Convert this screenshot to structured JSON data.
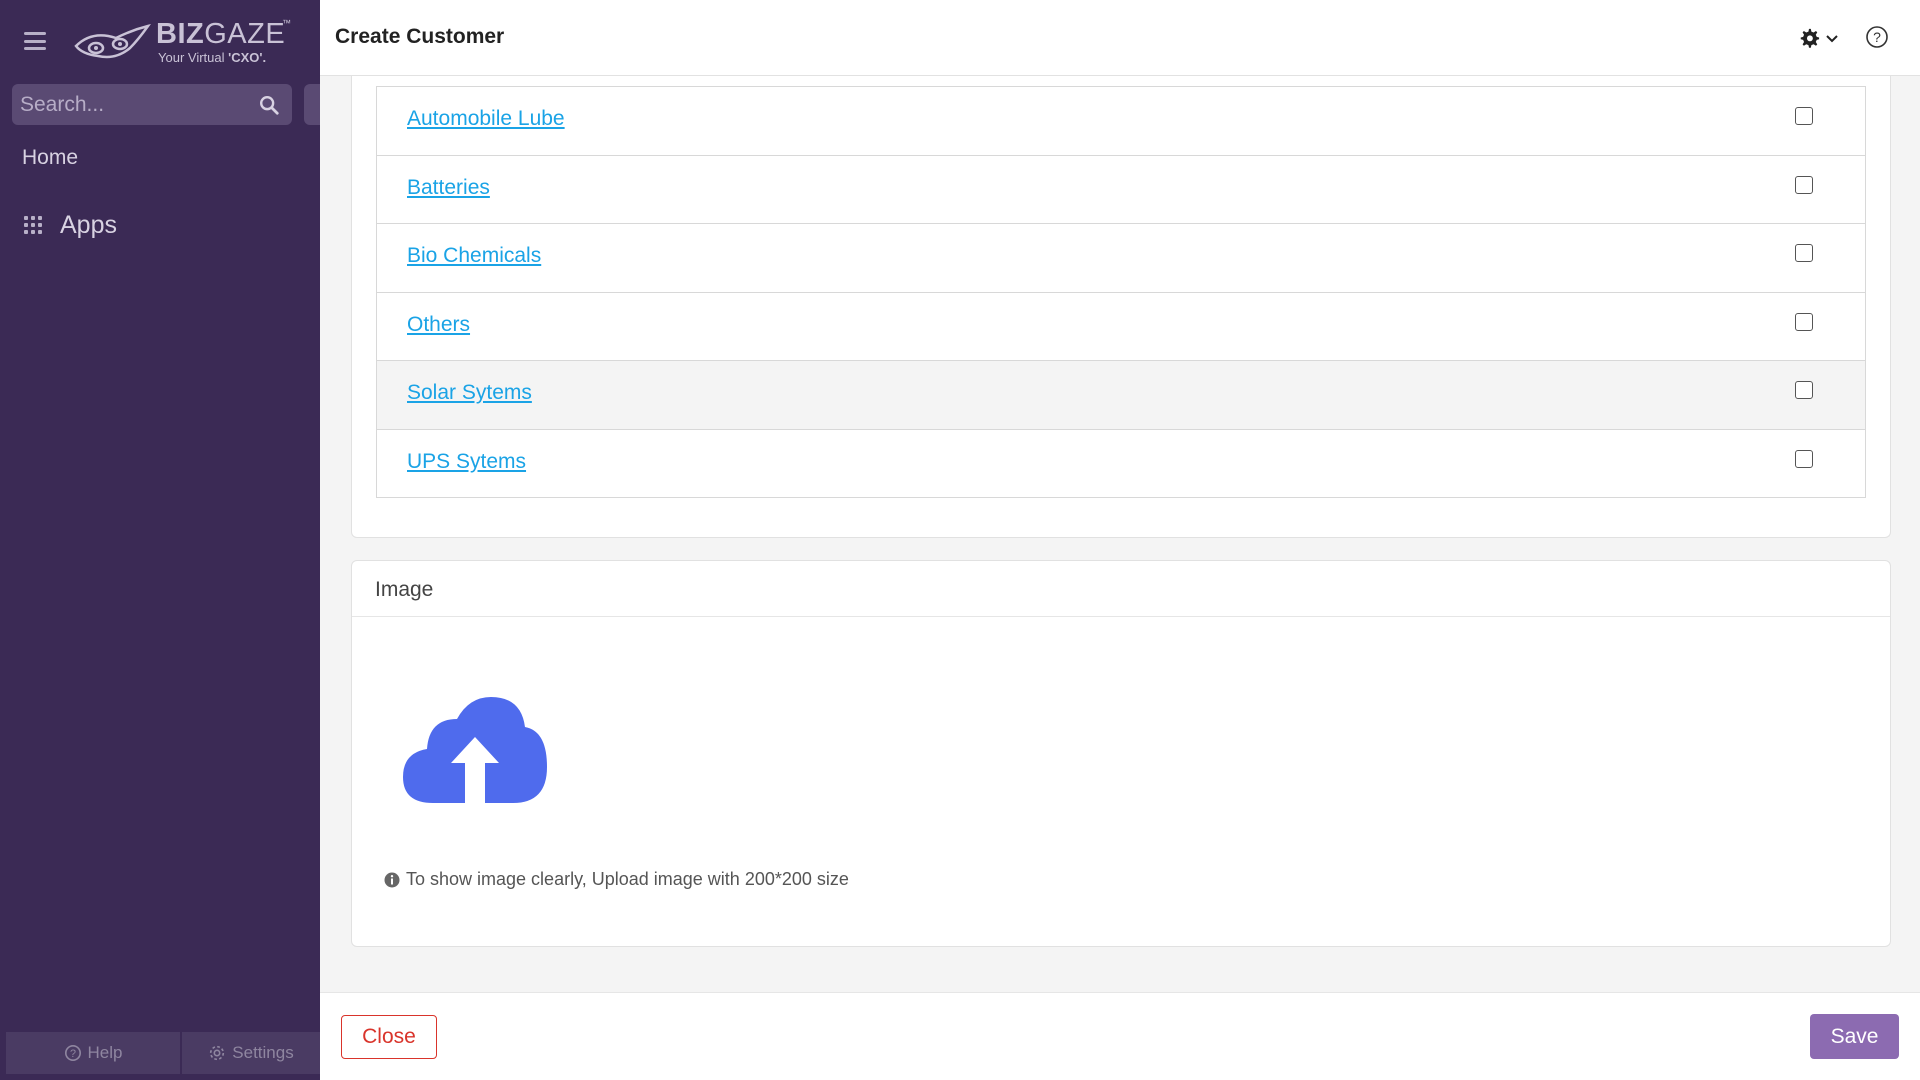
{
  "brand": {
    "logo_name_bold": "BIZ",
    "logo_name_rest": "GAZE",
    "logo_tm": "™",
    "logo_tagline_prefix": "Your Virtual ",
    "logo_tagline_bold": "'CXO'."
  },
  "sidebar": {
    "search_placeholder": "Search...",
    "nav": [
      {
        "label": "Home"
      },
      {
        "label": "Apps",
        "icon": "grid-icon"
      }
    ],
    "footer": {
      "help_label": "Help",
      "settings_label": "Settings"
    }
  },
  "modal": {
    "title": "Create Customer",
    "header_icons": [
      "gear-icon",
      "chevron-down-icon",
      "help-circle-icon"
    ],
    "categories": [
      {
        "label": "Automobile Lube",
        "checked": false
      },
      {
        "label": "Batteries",
        "checked": false
      },
      {
        "label": "Bio Chemicals",
        "checked": false
      },
      {
        "label": "Others",
        "checked": false
      },
      {
        "label": "Solar Sytems",
        "checked": false
      },
      {
        "label": "UPS Sytems",
        "checked": false
      }
    ],
    "image_section": {
      "title": "Image",
      "upload_icon": "cloud-upload-icon",
      "hint": "To show image clearly, Upload image with 200*200 size"
    },
    "footer": {
      "close_label": "Close",
      "save_label": "Save"
    }
  },
  "colors": {
    "sidebar_bg": "#3b2a55",
    "link": "#1aa3e6",
    "upload_icon": "#4f6bed",
    "save_bg": "#8c6bb1",
    "close_border": "#d9342b"
  }
}
